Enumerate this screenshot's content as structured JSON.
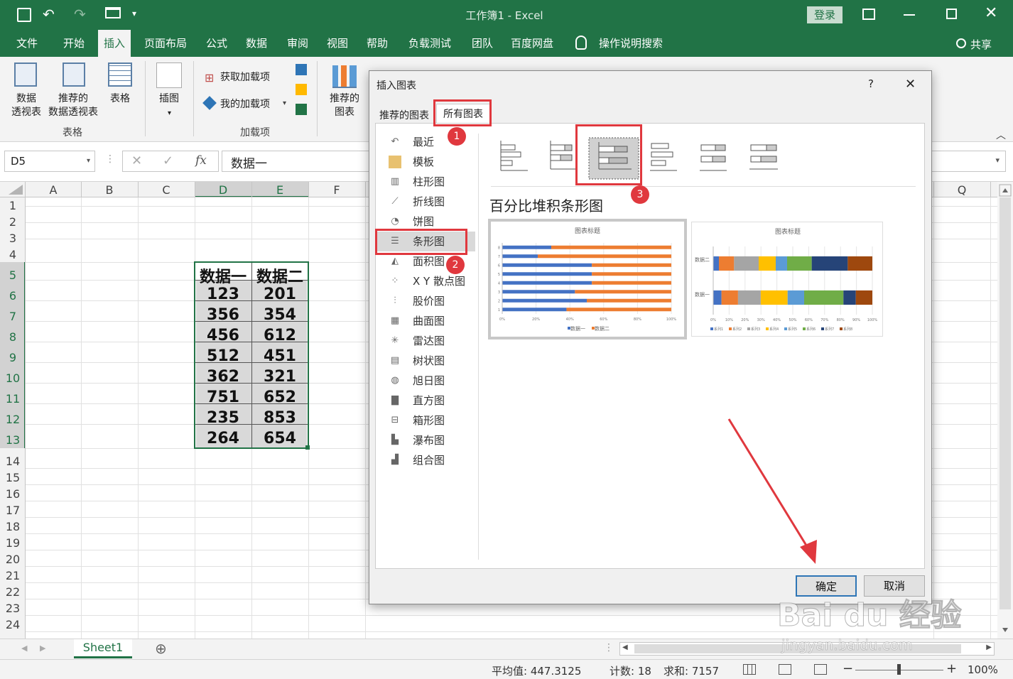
{
  "window": {
    "title": "工作簿1  -  Excel",
    "login_label": "登录",
    "share_label": "共享"
  },
  "ribbon_tabs": [
    "文件",
    "开始",
    "插入",
    "页面布局",
    "公式",
    "数据",
    "审阅",
    "视图",
    "帮助",
    "负载测试",
    "团队",
    "百度网盘",
    "操作说明搜索"
  ],
  "ribbon": {
    "pivot_label": "数据\n透视表",
    "rec_pivot_label": "推荐的\n数据透视表",
    "table_label": "表格",
    "group_tables": "表格",
    "illustrations_label": "插图",
    "get_addins": "获取加载项",
    "my_addins": "我的加载项",
    "group_addins": "加载项",
    "rec_charts_label": "推荐的\n图表"
  },
  "formula_bar": {
    "name_box": "D5",
    "fx": "fx",
    "value": "数据一"
  },
  "columns": [
    "A",
    "B",
    "C",
    "D",
    "E",
    "F",
    "Q"
  ],
  "rows": [
    "1",
    "2",
    "3",
    "4",
    "5",
    "6",
    "7",
    "8",
    "9",
    "10",
    "11",
    "12",
    "13",
    "14",
    "15",
    "16",
    "17",
    "18",
    "19",
    "20",
    "21",
    "22",
    "23",
    "24"
  ],
  "table": {
    "headers": [
      "数据一",
      "数据二"
    ],
    "rows": [
      [
        "123",
        "201"
      ],
      [
        "356",
        "354"
      ],
      [
        "456",
        "612"
      ],
      [
        "512",
        "451"
      ],
      [
        "362",
        "321"
      ],
      [
        "751",
        "652"
      ],
      [
        "235",
        "853"
      ],
      [
        "264",
        "654"
      ]
    ]
  },
  "dialog": {
    "title": "插入图表",
    "help": "?",
    "close": "✕",
    "tabs": [
      "推荐的图表",
      "所有图表"
    ],
    "categories": [
      "最近",
      "模板",
      "柱形图",
      "折线图",
      "饼图",
      "条形图",
      "面积图",
      "X Y 散点图",
      "股价图",
      "曲面图",
      "雷达图",
      "树状图",
      "旭日图",
      "直方图",
      "箱形图",
      "瀑布图",
      "组合图"
    ],
    "selected_category": "条形图",
    "subtype_title": "百分比堆积条形图",
    "preview_title": "图表标题",
    "ok_label": "确定",
    "cancel_label": "取消",
    "badges": [
      "1",
      "2",
      "3"
    ]
  },
  "chart_data": [
    {
      "type": "bar",
      "title": "图表标题",
      "categories": [
        "1",
        "2",
        "3",
        "4",
        "5",
        "6",
        "7",
        "8"
      ],
      "series": [
        {
          "name": "数据一",
          "values": [
            38,
            50,
            43,
            53,
            53,
            53,
            21,
            29
          ]
        },
        {
          "name": "数据二",
          "values": [
            62,
            50,
            57,
            47,
            47,
            47,
            79,
            71
          ]
        }
      ],
      "x_ticks": [
        "0%",
        "20%",
        "40%",
        "60%",
        "80%",
        "100%"
      ],
      "stacked_percent": true,
      "colors": [
        "#4472c4",
        "#ed7d31"
      ]
    },
    {
      "type": "bar",
      "title": "图表标题",
      "categories": [
        "数据一",
        "数据二"
      ],
      "series": [
        {
          "name": "系列1",
          "values": [
            4,
            3
          ]
        },
        {
          "name": "系列2",
          "values": [
            8,
            8
          ]
        },
        {
          "name": "系列3",
          "values": [
            11,
            13
          ]
        },
        {
          "name": "系列4",
          "values": [
            13,
            9
          ]
        },
        {
          "name": "系列5",
          "values": [
            8,
            6
          ]
        },
        {
          "name": "系列6",
          "values": [
            19,
            13
          ]
        },
        {
          "name": "系列7",
          "values": [
            6,
            19
          ]
        },
        {
          "name": "系列8",
          "values": [
            8,
            13
          ]
        }
      ],
      "x_ticks": [
        "0%",
        "10%",
        "20%",
        "30%",
        "40%",
        "50%",
        "60%",
        "70%",
        "80%",
        "90%",
        "100%"
      ],
      "stacked_percent": true,
      "colors": [
        "#4472c4",
        "#ed7d31",
        "#a5a5a5",
        "#ffc000",
        "#5b9bd5",
        "#70ad47",
        "#264478",
        "#9e480e"
      ]
    }
  ],
  "sheet": {
    "tab": "Sheet1",
    "add": "⊕"
  },
  "status": {
    "average": "平均值: 447.3125",
    "count": "计数: 18",
    "sum": "求和: 7157",
    "zoom": "100%"
  },
  "watermark": {
    "brand": "Bai du 经验",
    "url": "jingyan.baidu.com"
  }
}
